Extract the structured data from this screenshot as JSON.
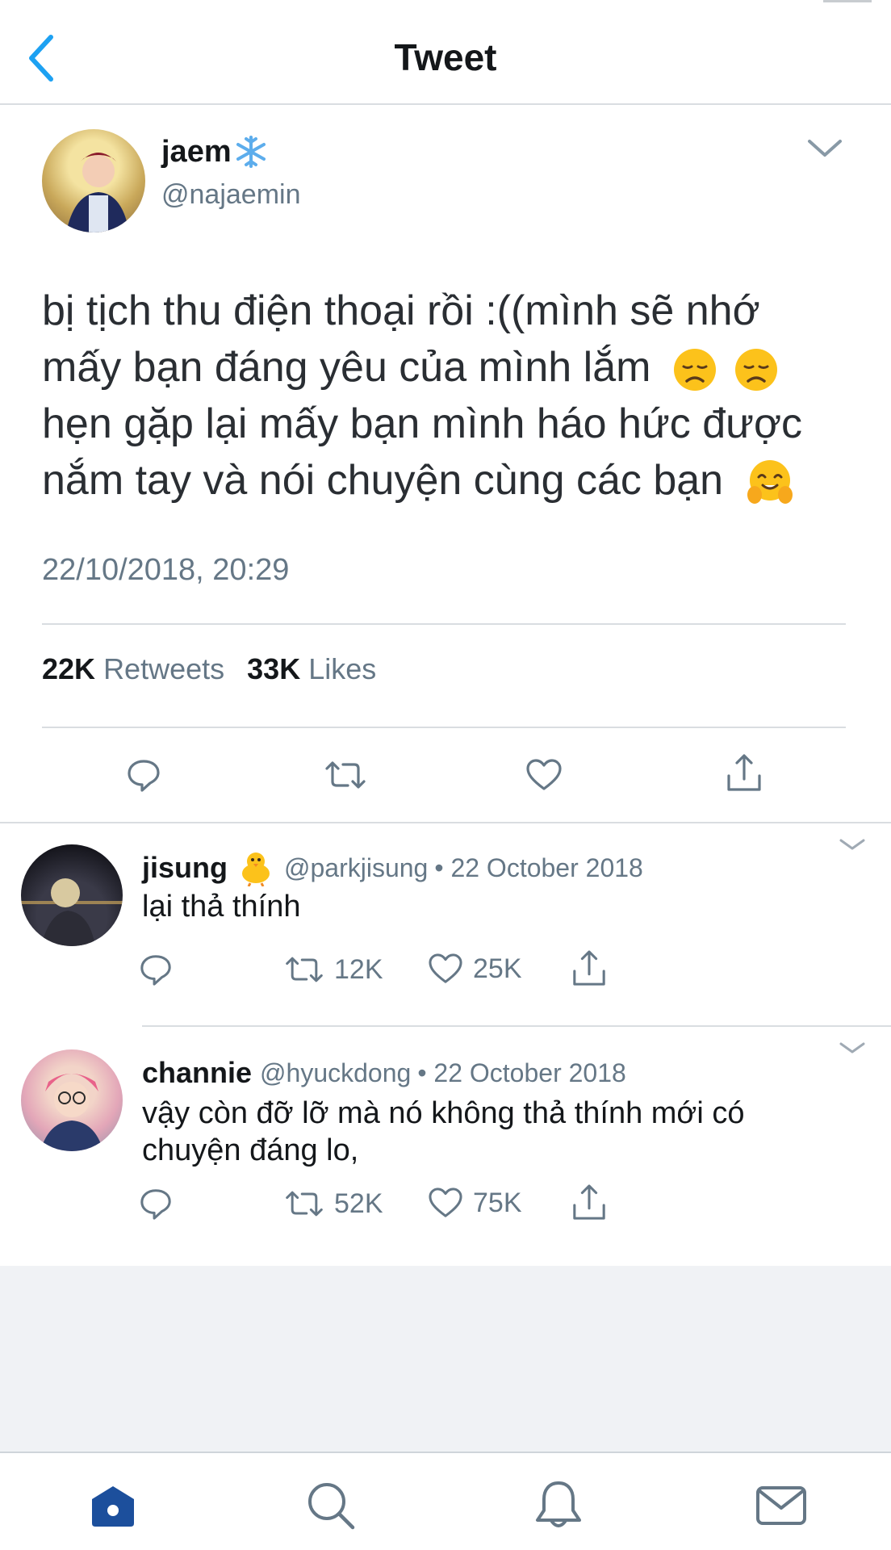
{
  "header": {
    "title": "Tweet"
  },
  "tweet": {
    "display_name": "jaem",
    "name_emoji_icon": "snowflake-emoji",
    "handle": "@najaemin",
    "text_line1": "bị tịch thu điện thoại rồi :((mình sẽ nhớ",
    "text_line2": "mấy bạn đáng yêu của mình lắm",
    "text_line3": "hẹn gặp lại mấy bạn mình háo hức được",
    "text_line4": "nắm tay và nói chuyện cùng các bạn",
    "emojis": [
      "disappointed-face-emoji",
      "disappointed-face-emoji",
      "hugging-face-emoji"
    ],
    "timestamp": "22/10/2018, 20:29",
    "retweets_count": "22K",
    "retweets_label": "Retweets",
    "likes_count": "33K",
    "likes_label": "Likes"
  },
  "replies": [
    {
      "display_name": "jisung",
      "name_emoji_icon": "baby-chick-emoji",
      "handle": "@parkjisung",
      "date": "• 22 October 2018",
      "text_line1": "lại thả thính",
      "text_line2": "",
      "retweets": "12K",
      "likes": "25K"
    },
    {
      "display_name": "channie",
      "handle": "@hyuckdong",
      "date": "• 22 October 2018",
      "text_line1": "vậy còn đỡ lỡ mà nó không thả thính mới có",
      "text_line2": "chuyện đáng lo,",
      "retweets": "52K",
      "likes": "75K"
    }
  ],
  "bottom_nav": [
    "home-icon",
    "search-icon",
    "notifications-icon",
    "messages-icon"
  ],
  "colors": {
    "accent": "#1da1f2",
    "nav_active": "#1c4f9c",
    "muted": "#657786",
    "divider": "#d9dde1",
    "footer_bg": "#f0f2f5"
  }
}
